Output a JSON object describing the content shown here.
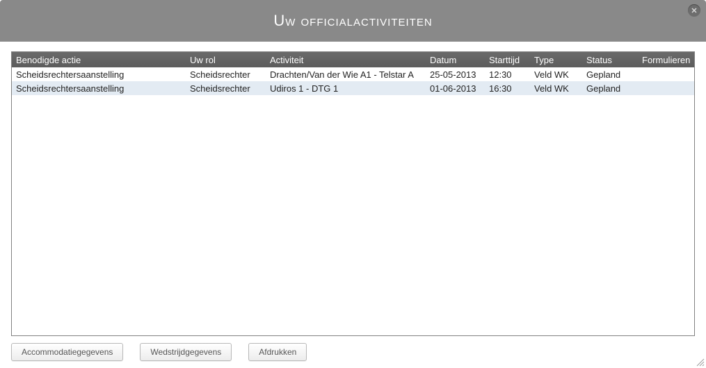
{
  "title": "Uw officialactiviteiten",
  "columns": {
    "actie": "Benodigde actie",
    "rol": "Uw rol",
    "activiteit": "Activiteit",
    "datum": "Datum",
    "starttijd": "Starttijd",
    "type": "Type",
    "status": "Status",
    "formulieren": "Formulieren"
  },
  "rows": [
    {
      "actie": "Scheidsrechtersaanstelling",
      "rol": "Scheidsrechter",
      "activiteit": "Drachten/Van der Wie A1 - Telstar A",
      "datum": "25-05-2013",
      "starttijd": "12:30",
      "type": "Veld WK",
      "status": "Gepland",
      "formulieren": ""
    },
    {
      "actie": "Scheidsrechtersaanstelling",
      "rol": "Scheidsrechter",
      "activiteit": "Udiros 1 - DTG 1",
      "datum": "01-06-2013",
      "starttijd": "16:30",
      "type": "Veld WK",
      "status": "Gepland",
      "formulieren": ""
    }
  ],
  "buttons": {
    "accommodatie": "Accommodatiegegevens",
    "wedstrijd": "Wedstrijdgegevens",
    "afdrukken": "Afdrukken"
  }
}
